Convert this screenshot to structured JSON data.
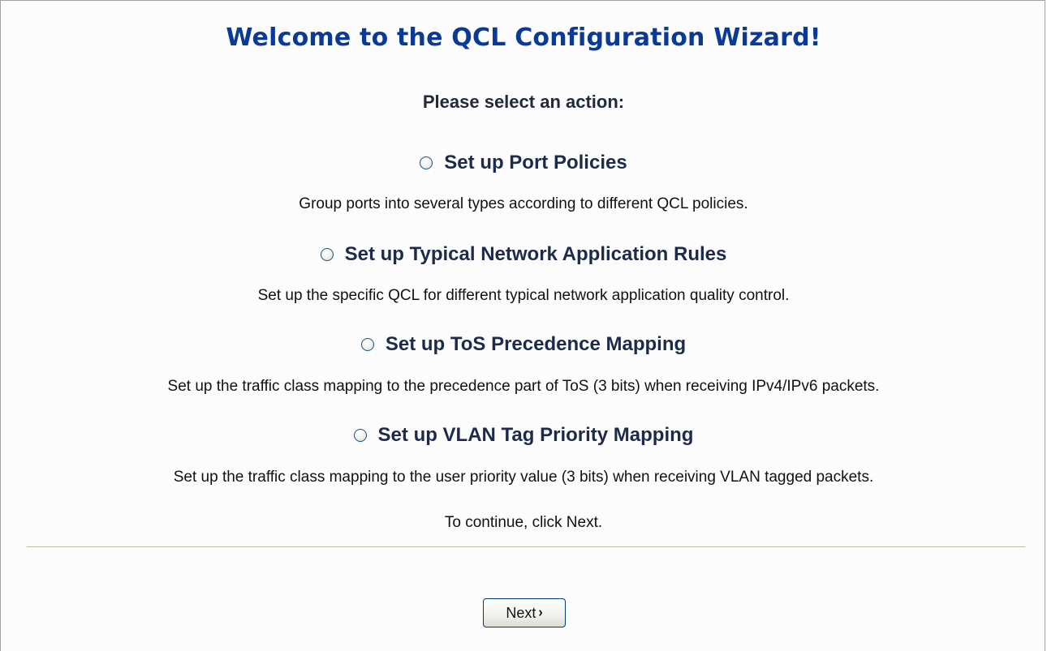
{
  "wizard": {
    "title": "Welcome to the QCL Configuration Wizard!",
    "prompt": "Please select an action:",
    "options": [
      {
        "label": "Set up Port Policies",
        "description": "Group ports into several types according to different QCL policies.",
        "selected": false
      },
      {
        "label": "Set up Typical Network Application Rules",
        "description": "Set up the specific QCL for different typical network application quality control.",
        "selected": false
      },
      {
        "label": "Set up ToS Precedence Mapping",
        "description": "Set up the traffic class mapping to the precedence part of ToS (3 bits) when receiving IPv4/IPv6 packets.",
        "selected": false
      },
      {
        "label": "Set up VLAN Tag Priority Mapping",
        "description": "Set up the traffic class mapping to the user priority value (3 bits) when receiving VLAN tagged packets.",
        "selected": false
      }
    ],
    "continue_hint": "To continue, click Next.",
    "next_label": "Next",
    "next_chevron": "›"
  },
  "colors": {
    "title": "#0a3a96",
    "option_text": "#1e2a4a",
    "background": "#fcfcfc",
    "divider": "#c2b8a3",
    "button_border": "#003c74"
  }
}
